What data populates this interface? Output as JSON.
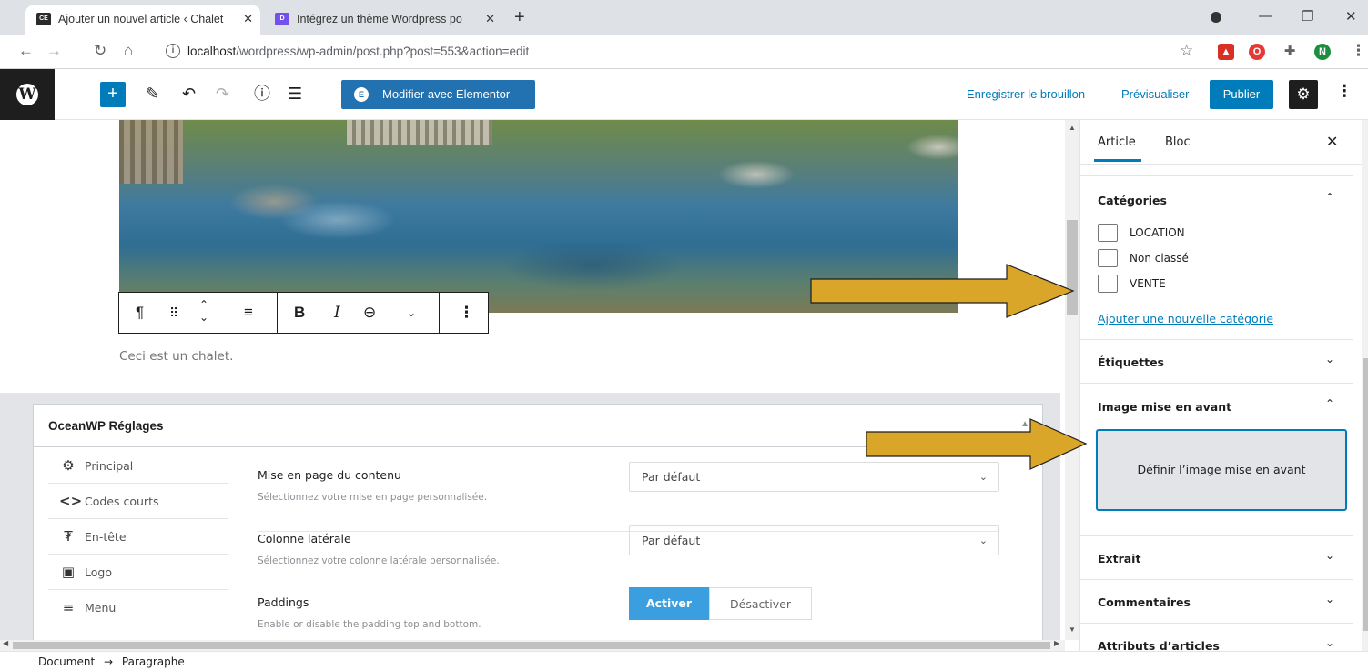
{
  "browser": {
    "tabs": [
      {
        "title": "Ajouter un nouvel article ‹ Chalet",
        "active": true
      },
      {
        "title": "Intégrez un thème Wordpress po",
        "active": false
      }
    ],
    "url_host": "localhost",
    "url_path": "/wordpress/wp-admin/post.php?post=553&action=edit",
    "profile_initial": "N"
  },
  "toolbar": {
    "elementor_label": "Modifier avec Elementor",
    "save_draft_label": "Enregistrer le brouillon",
    "preview_label": "Prévisualiser",
    "publish_label": "Publier"
  },
  "editor": {
    "paragraph_text": "Ceci est un chalet."
  },
  "oceanwp": {
    "title": "OceanWP Réglages",
    "nav": [
      {
        "label": "Principal",
        "icon": "gear-icon"
      },
      {
        "label": "Codes courts",
        "icon": "code-icon"
      },
      {
        "label": "En-tête",
        "icon": "pin-icon"
      },
      {
        "label": "Logo",
        "icon": "image-icon"
      },
      {
        "label": "Menu",
        "icon": "menu-icon"
      }
    ],
    "settings": [
      {
        "title": "Mise en page du contenu",
        "desc": "Sélectionnez votre mise en page personnalisée.",
        "value": "Par défaut"
      },
      {
        "title": "Colonne latérale",
        "desc": "Sélectionnez votre colonne latérale personnalisée.",
        "value": "Par défaut"
      },
      {
        "title": "Paddings",
        "desc": "Enable or disable the padding top and bottom.",
        "on_label": "Activer",
        "off_label": "Désactiver"
      }
    ]
  },
  "breadcrumb": {
    "document": "Document",
    "separator": "→",
    "current": "Paragraphe"
  },
  "sidebar": {
    "tab_article": "Article",
    "tab_block": "Bloc",
    "categories_title": "Catégories",
    "categories": [
      "LOCATION",
      "Non classé",
      "VENTE"
    ],
    "add_category": "Ajouter une nouvelle catégorie",
    "tags_title": "Étiquettes",
    "featured_title": "Image mise en avant",
    "featured_button": "Définir l’image mise en avant",
    "excerpt_title": "Extrait",
    "comments_title": "Commentaires",
    "attributes_title": "Attributs d’articles"
  },
  "colors": {
    "accent": "#007cba",
    "arrow": "#d9a62a",
    "activer": "#3b9edf"
  }
}
